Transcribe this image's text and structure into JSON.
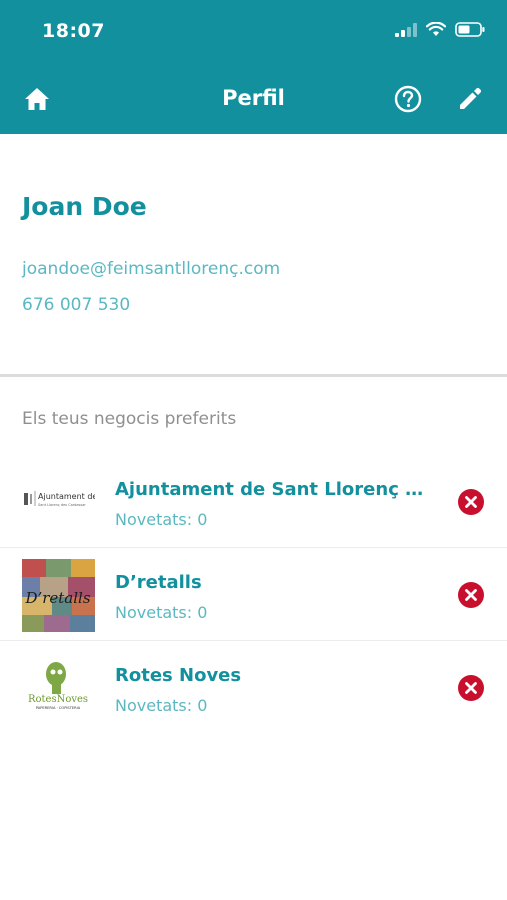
{
  "status": {
    "time": "18:07"
  },
  "header": {
    "title": "Perfil"
  },
  "profile": {
    "name": "Joan Doe",
    "email": "joandoe@feimsantllorenç.com",
    "phone": "676 007 530"
  },
  "favorites": {
    "title": "Els teus negocis preferits",
    "items": [
      {
        "name": "Ajuntament de Sant Llorenç d...",
        "news": "Novetats: 0",
        "logo_text": "Ajuntament de",
        "logo_subtext": "Sant Llorenç des Cardassar"
      },
      {
        "name": "D’retalls",
        "news": "Novetats: 0",
        "logo_text": "D’retalls"
      },
      {
        "name": "Rotes Noves",
        "news": "Novetats: 0",
        "logo_text": "RotesNoves",
        "logo_subtext": "PAPERERIA · COPISTERIA"
      }
    ]
  },
  "colors": {
    "primary": "#13909e",
    "accent_light": "#5bb8c2",
    "remove": "#c8102e"
  }
}
